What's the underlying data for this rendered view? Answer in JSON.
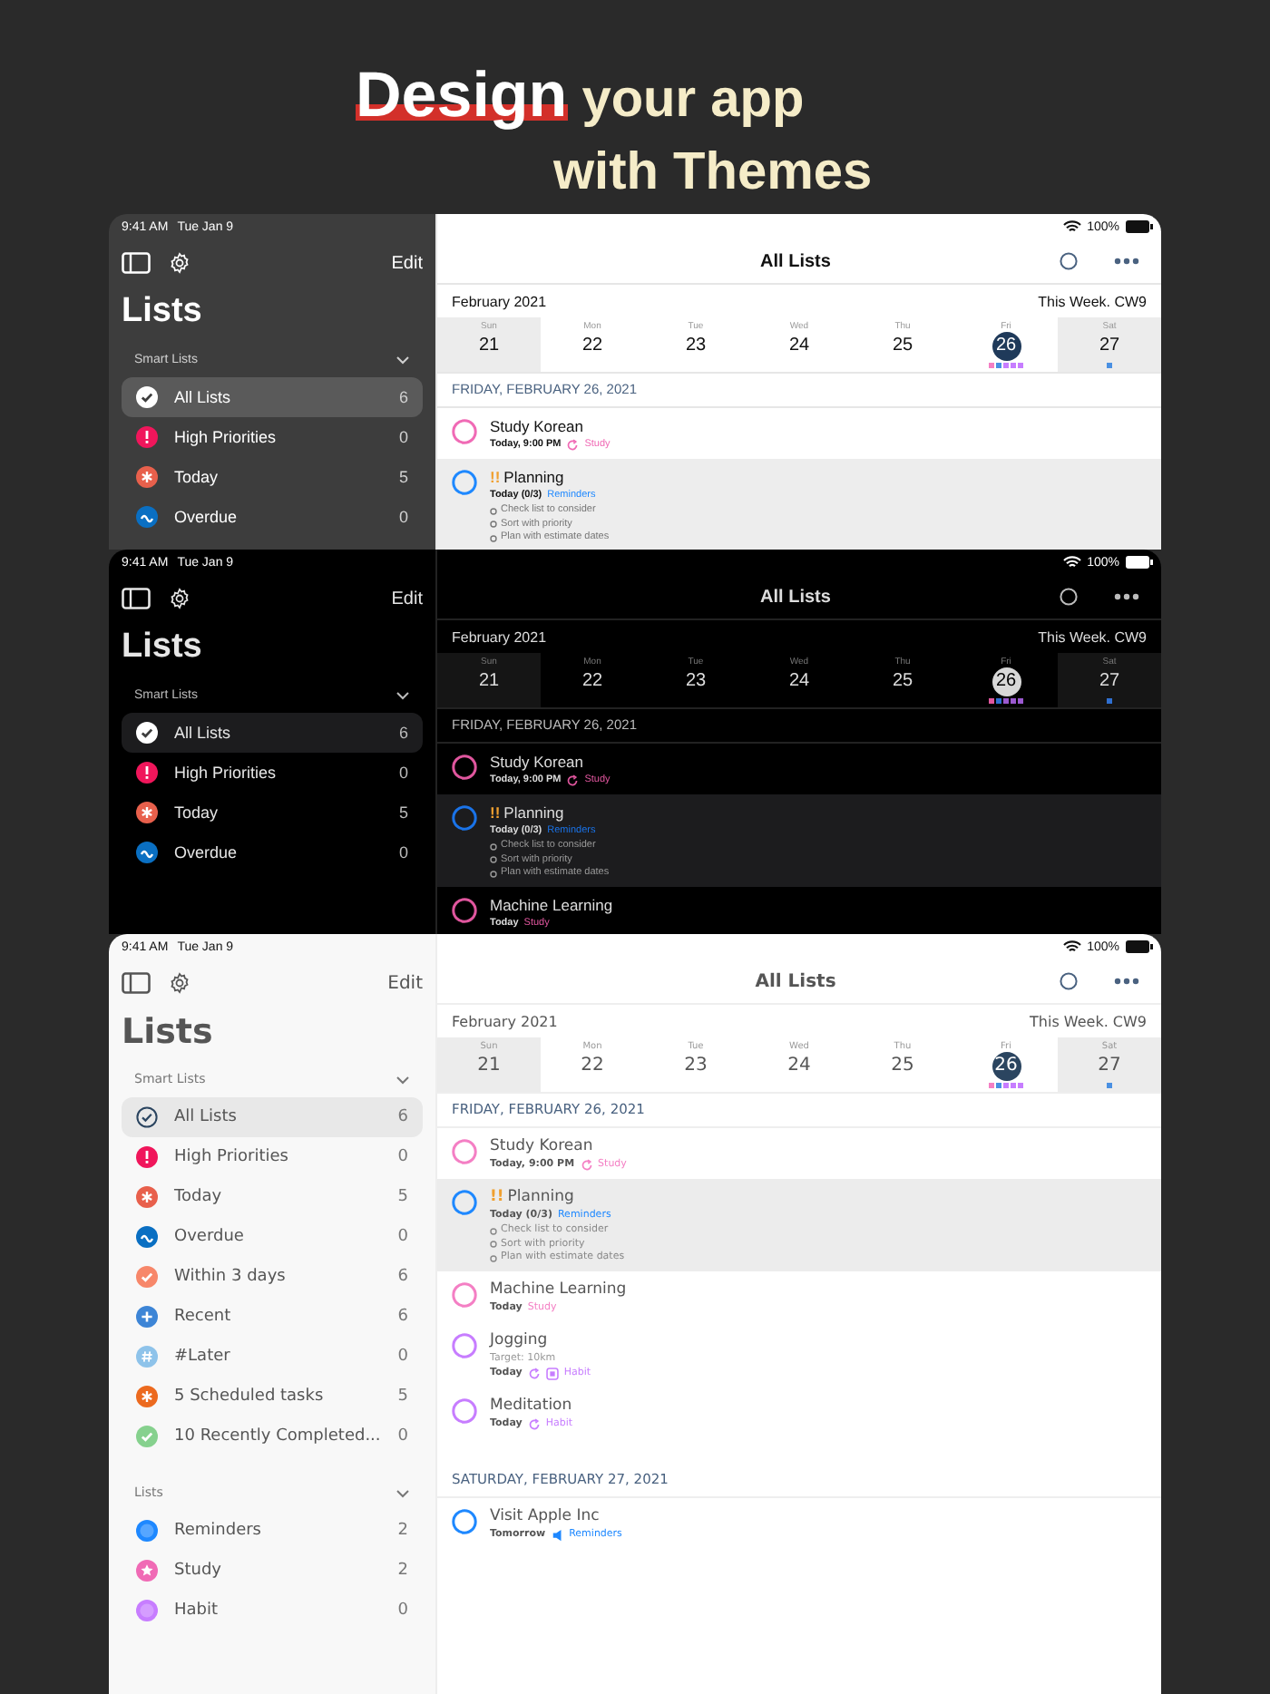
{
  "headline": {
    "lines": [
      [
        {
          "text": "Design",
          "highlight": true
        },
        {
          "text": "your app",
          "highlight": false
        }
      ],
      [
        {
          "text": "with Themes",
          "highlight": false
        }
      ]
    ]
  },
  "screens": [
    {
      "kind": "light",
      "status": {
        "time": "9:41 AM",
        "date": "Tue Jan 9",
        "battery": "100%"
      },
      "sidebar": {
        "edit": "Edit",
        "title": "Lists",
        "sections": [
          {
            "title": "Smart Lists",
            "expanded": true,
            "items": [
              {
                "label": "All Lists",
                "count": "6",
                "kind": "check",
                "color": "#ffffff",
                "selected": true
              },
              {
                "label": "High Priorities",
                "count": "0",
                "kind": "exclaim",
                "color": "#f0165b",
                "selected": false
              },
              {
                "label": "Today",
                "count": "5",
                "kind": "asterisk",
                "color": "#e8604c",
                "selected": false
              },
              {
                "label": "Overdue",
                "count": "0",
                "kind": "wave",
                "color": "#0a6fc2",
                "selected": false
              }
            ]
          }
        ]
      },
      "main": {
        "title": "All Lists",
        "month": "February 2021",
        "week": "This Week. CW9",
        "days": [
          {
            "name": "Sun",
            "num": "21",
            "weekend": true,
            "selected": false
          },
          {
            "name": "Mon",
            "num": "22",
            "weekend": false,
            "selected": false
          },
          {
            "name": "Tue",
            "num": "23",
            "weekend": false,
            "selected": false
          },
          {
            "name": "Wed",
            "num": "24",
            "weekend": false,
            "selected": false
          },
          {
            "name": "Thu",
            "num": "25",
            "weekend": false,
            "selected": false
          },
          {
            "name": "Fri",
            "num": "26",
            "weekend": false,
            "selected": true,
            "dots": [
              {
                "color": "#f47fc4"
              },
              {
                "color": "#4a90e2"
              },
              {
                "color": "#c77dff"
              },
              {
                "color": "#c77dff"
              },
              {
                "color": "#c77dff"
              }
            ]
          },
          {
            "name": "Sat",
            "num": "27",
            "weekend": true,
            "selected": false,
            "dots": [
              {
                "color": "#4a90e2"
              }
            ]
          }
        ],
        "sections": [
          {
            "heading": "FRIDAY, FEBRUARY 26, 2021",
            "tasks": [
              {
                "title": "Study Korean",
                "date": "Today, 9:00 PM",
                "list": "Study",
                "kind": "repeat",
                "color": "#f06ab5",
                "selected": false
              },
              {
                "title": "Planning",
                "priority": "!!",
                "date": "Today (0/3)",
                "list": "Reminders",
                "kind": "plain",
                "color": "#1e88ff",
                "selected": true,
                "subitems": [
                  "Check list to consider",
                  "Sort with priority",
                  "Plan with estimate dates"
                ]
              }
            ]
          }
        ]
      }
    },
    {
      "kind": "dark",
      "status": {
        "time": "9:41 AM",
        "date": "Tue Jan 9",
        "battery": "100%"
      },
      "sidebar": {
        "edit": "Edit",
        "title": "Lists",
        "sections": [
          {
            "title": "Smart Lists",
            "expanded": true,
            "items": [
              {
                "label": "All Lists",
                "count": "6",
                "kind": "check",
                "color": "#ffffff",
                "selected": true
              },
              {
                "label": "High Priorities",
                "count": "0",
                "kind": "exclaim",
                "color": "#f0165b",
                "selected": false
              },
              {
                "label": "Today",
                "count": "5",
                "kind": "asterisk",
                "color": "#e8604c",
                "selected": false
              },
              {
                "label": "Overdue",
                "count": "0",
                "kind": "wave",
                "color": "#0a6fc2",
                "selected": false
              }
            ]
          }
        ]
      },
      "main": {
        "title": "All Lists",
        "month": "February 2021",
        "week": "This Week. CW9",
        "days": [
          {
            "name": "Sun",
            "num": "21",
            "weekend": true,
            "selected": false
          },
          {
            "name": "Mon",
            "num": "22",
            "weekend": false,
            "selected": false
          },
          {
            "name": "Tue",
            "num": "23",
            "weekend": false,
            "selected": false
          },
          {
            "name": "Wed",
            "num": "24",
            "weekend": false,
            "selected": false
          },
          {
            "name": "Thu",
            "num": "25",
            "weekend": false,
            "selected": false
          },
          {
            "name": "Fri",
            "num": "26",
            "weekend": false,
            "selected": true,
            "dots": [
              {
                "color": "#e0569e"
              },
              {
                "color": "#2f6fd0"
              },
              {
                "color": "#9b59d0"
              },
              {
                "color": "#9b59d0"
              },
              {
                "color": "#9b59d0"
              }
            ]
          },
          {
            "name": "Sat",
            "num": "27",
            "weekend": true,
            "selected": false,
            "dots": [
              {
                "color": "#2f6fd0"
              }
            ]
          }
        ],
        "sections": [
          {
            "heading": "FRIDAY, FEBRUARY 26, 2021",
            "tasks": [
              {
                "title": "Study Korean",
                "date": "Today, 9:00 PM",
                "list": "Study",
                "kind": "repeat",
                "color": "#e0569e",
                "selected": false
              },
              {
                "title": "Planning",
                "priority": "!!",
                "date": "Today (0/3)",
                "list": "Reminders",
                "kind": "plain",
                "color": "#1a73e8",
                "selected": true,
                "subitems": [
                  "Check list to consider",
                  "Sort with priority",
                  "Plan with estimate dates"
                ]
              },
              {
                "title": "Machine Learning",
                "date": "Today",
                "list": "Study",
                "kind": "plain",
                "color": "#e0569e",
                "selected": false
              }
            ]
          }
        ]
      }
    },
    {
      "kind": "sketch",
      "status": {
        "time": "9:41 AM",
        "date": "Tue Jan 9",
        "battery": "100%"
      },
      "sidebar": {
        "edit": "Edit",
        "title": "Lists",
        "sections": [
          {
            "title": "Smart Lists",
            "expanded": true,
            "items": [
              {
                "label": "All Lists",
                "count": "6",
                "kind": "check-outline",
                "color": "#2b4560",
                "selected": true
              },
              {
                "label": "High Priorities",
                "count": "0",
                "kind": "exclaim",
                "color": "#f0165b",
                "selected": false
              },
              {
                "label": "Today",
                "count": "5",
                "kind": "asterisk",
                "color": "#e8604c",
                "selected": false
              },
              {
                "label": "Overdue",
                "count": "0",
                "kind": "wave",
                "color": "#0a6fc2",
                "selected": false
              },
              {
                "label": "Within 3 days",
                "count": "6",
                "kind": "check",
                "color": "#f7876a",
                "selected": false
              },
              {
                "label": "Recent",
                "count": "6",
                "kind": "plus",
                "color": "#3d85d6",
                "selected": false
              },
              {
                "label": "#Later",
                "count": "0",
                "kind": "hash",
                "color": "#8ec3ea",
                "selected": false
              },
              {
                "label": "5 Scheduled tasks",
                "count": "5",
                "kind": "asterisk",
                "color": "#ec6a1f",
                "selected": false
              },
              {
                "label": "10 Recently Completed...",
                "count": "0",
                "kind": "check",
                "color": "#86d18e",
                "selected": false
              }
            ]
          },
          {
            "title": "Lists",
            "expanded": true,
            "items": [
              {
                "label": "Reminders",
                "count": "2",
                "kind": "dot",
                "color": "#1e88ff",
                "selected": false
              },
              {
                "label": "Study",
                "count": "2",
                "kind": "star",
                "color": "#f06ab5",
                "selected": false
              },
              {
                "label": "Habit",
                "count": "0",
                "kind": "dot",
                "color": "#c77dff",
                "selected": false
              }
            ]
          }
        ]
      },
      "main": {
        "title": "All Lists",
        "month": "February 2021",
        "week": "This Week. CW9",
        "days": [
          {
            "name": "Sun",
            "num": "21",
            "weekend": true,
            "selected": false
          },
          {
            "name": "Mon",
            "num": "22",
            "weekend": false,
            "selected": false
          },
          {
            "name": "Tue",
            "num": "23",
            "weekend": false,
            "selected": false
          },
          {
            "name": "Wed",
            "num": "24",
            "weekend": false,
            "selected": false
          },
          {
            "name": "Thu",
            "num": "25",
            "weekend": false,
            "selected": false
          },
          {
            "name": "Fri",
            "num": "26",
            "weekend": false,
            "selected": true,
            "dots": [
              {
                "color": "#f47fc4"
              },
              {
                "color": "#4a90e2"
              },
              {
                "color": "#c77dff"
              },
              {
                "color": "#c77dff"
              },
              {
                "color": "#c77dff"
              }
            ]
          },
          {
            "name": "Sat",
            "num": "27",
            "weekend": true,
            "selected": false,
            "dots": [
              {
                "color": "#4a90e2"
              }
            ]
          }
        ],
        "sections": [
          {
            "heading": "FRIDAY, FEBRUARY 26, 2021",
            "tasks": [
              {
                "title": "Study Korean",
                "date": "Today, 9:00 PM",
                "list": "Study",
                "kind": "repeat",
                "color": "#f47fc4",
                "selected": false
              },
              {
                "title": "Planning",
                "priority": "!!",
                "date": "Today (0/3)",
                "list": "Reminders",
                "kind": "plain",
                "color": "#1e88ff",
                "selected": true,
                "subitems": [
                  "Check list to consider",
                  "Sort with priority",
                  "Plan with estimate dates"
                ]
              },
              {
                "title": "Machine Learning",
                "date": "Today",
                "list": "Study",
                "kind": "plain",
                "color": "#f47fc4",
                "selected": false
              },
              {
                "title": "Jogging",
                "note": "Target: 10km",
                "date": "Today",
                "list": "Habit",
                "kind": "repeat-habit",
                "color": "#c77dff",
                "selected": false
              },
              {
                "title": "Meditation",
                "date": "Today",
                "list": "Habit",
                "kind": "repeat",
                "color": "#c77dff",
                "selected": false
              }
            ]
          },
          {
            "heading": "SATURDAY, FEBRUARY 27, 2021",
            "tasks": [
              {
                "title": "Visit Apple Inc",
                "date": "Tomorrow",
                "list": "Reminders",
                "kind": "speaker",
                "color": "#1e88ff",
                "selected": false
              }
            ]
          }
        ]
      }
    }
  ]
}
